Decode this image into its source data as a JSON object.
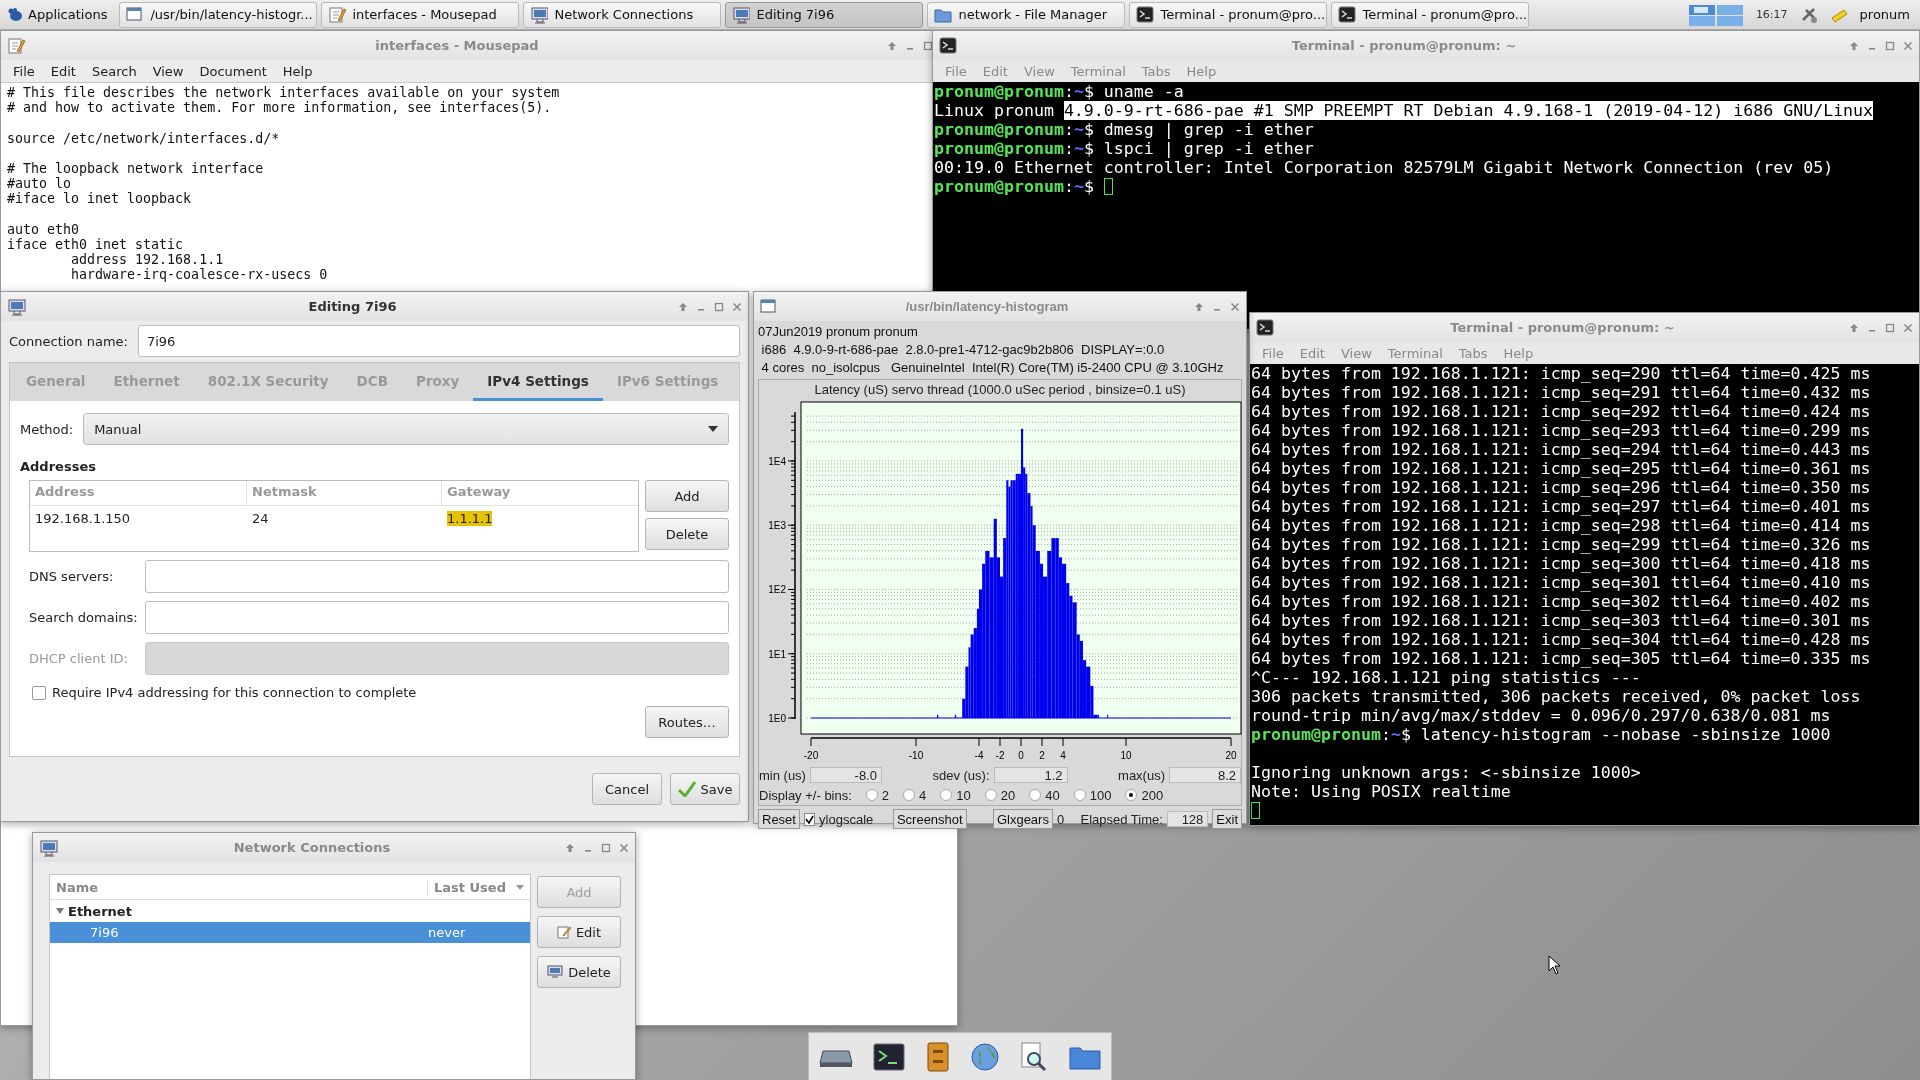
{
  "taskbar": {
    "menu_label": "Applications",
    "tasks": [
      {
        "title": "/usr/bin/latency-histogr...",
        "selected": false
      },
      {
        "title": "interfaces - Mousepad",
        "selected": false
      },
      {
        "title": "Network Connections",
        "selected": false
      },
      {
        "title": "Editing 7i96",
        "selected": true
      },
      {
        "title": "network - File Manager",
        "selected": false
      },
      {
        "title": "Terminal - pronum@pro...",
        "selected": false
      },
      {
        "title": "Terminal - pronum@pro...",
        "selected": false
      }
    ],
    "clock": "16:17",
    "user": "pronum"
  },
  "mousepad": {
    "title": "interfaces - Mousepad",
    "menu": [
      "File",
      "Edit",
      "Search",
      "View",
      "Document",
      "Help"
    ],
    "blocks": [
      [
        "# This file describes the network interfaces available on your system",
        "# and how to activate them. For more information, see interfaces(5)."
      ],
      [
        "source /etc/network/interfaces.d/*"
      ],
      [
        "# The loopback network interface",
        "#auto lo",
        "#iface lo inet loopback"
      ],
      [
        "auto eth0",
        "iface eth0 inet static",
        "        address 192.168.1.1",
        "        hardware-irq-coalesce-rx-usecs 0"
      ]
    ]
  },
  "terminal_top": {
    "title": "Terminal - pronum@pronum: ~",
    "menu": [
      "File",
      "Edit",
      "View",
      "Terminal",
      "Tabs",
      "Help"
    ],
    "lines": [
      {
        "kind": "prompt",
        "user": "pronum@pronum",
        "colon": ":",
        "dir": "~",
        "dollar": "$",
        "command": "uname -a"
      },
      {
        "kind": "output",
        "text": "Linux pronum ",
        "highlight": "4.9.0-9-rt-686-pae #1 SMP PREEMPT RT Debian 4.9.168-1 (2019-04-12) i686 GNU/Linux"
      },
      {
        "kind": "prompt",
        "user": "pronum@pronum",
        "colon": ":",
        "dir": "~",
        "dollar": "$",
        "command": "dmesg | grep -i ether"
      },
      {
        "kind": "prompt",
        "user": "pronum@pronum",
        "colon": ":",
        "dir": "~",
        "dollar": "$",
        "command": "lspci | grep -i ether"
      },
      {
        "kind": "output",
        "text": "00:19.0 Ethernet controller: Intel Corporation 82579LM Gigabit Network Connection (rev 05)"
      },
      {
        "kind": "prompt",
        "user": "pronum@pronum",
        "colon": ":",
        "dir": "~",
        "dollar": "$",
        "cursor": true
      }
    ]
  },
  "editing": {
    "title": "Editing 7i96",
    "connection_name_label": "Connection name:",
    "connection_name": "7i96",
    "tabs": [
      {
        "label": "General",
        "selected": false
      },
      {
        "label": "Ethernet",
        "selected": false
      },
      {
        "label": "802.1X Security",
        "selected": false
      },
      {
        "label": "DCB",
        "selected": false
      },
      {
        "label": "Proxy",
        "selected": false
      },
      {
        "label": "IPv4 Settings",
        "selected": true
      },
      {
        "label": "IPv6 Settings",
        "selected": false
      }
    ],
    "method_label": "Method:",
    "method": "Manual",
    "addresses_heading": "Addresses",
    "address_columns": [
      "Address",
      "Netmask",
      "Gateway"
    ],
    "address_rows": [
      {
        "cells": [
          {
            "text": "192.168.1.150",
            "selected": false
          },
          {
            "text": "24",
            "selected": false
          },
          {
            "text": "1.1.1.1",
            "selected": true
          }
        ]
      }
    ],
    "address_buttons": [
      "Add",
      "Delete"
    ],
    "fields": [
      {
        "label": "DNS servers:",
        "disabled": false
      },
      {
        "label": "Search domains:",
        "disabled": false
      },
      {
        "label": "DHCP client ID:",
        "disabled": true
      }
    ],
    "require_checkbox": {
      "label": "Require IPv4 addressing for this connection to complete",
      "checked": false
    },
    "routes_button": "Routes…",
    "buttons": [
      {
        "label": "Cancel",
        "kind": "plain"
      },
      {
        "label": "Save",
        "kind": "confirm"
      }
    ]
  },
  "histogram": {
    "title": "/usr/bin/latency-histogram",
    "info_lines": [
      "07Jun2019 pronum pronum",
      " i686  4.9.0-9-rt-686-pae  2.8.0-pre1-4712-gac9b2b806  DISPLAY=:0.0",
      " 4 cores  no_isolcpus   GenuineIntel  Intel(R) Core(TM) i5-2400 CPU @ 3.10GHz"
    ],
    "plot": {
      "title": "Latency (uS) servo thread (1000.0 uSec period , binsize=0.1 uS)",
      "x_labels": [
        "-20",
        "-10",
        "-4",
        "-2",
        "0",
        "2",
        "4",
        "10",
        "20"
      ],
      "y_labels": [
        "1E4",
        "1E3",
        "1E2",
        "1E1",
        "1E0"
      ]
    },
    "stats": [
      {
        "label": "min (us)",
        "value": "-8.0"
      },
      {
        "label": "sdev (us):",
        "value": "1.2"
      },
      {
        "label": "max(us)",
        "value": "8.2"
      }
    ],
    "bins_label": "Display +/- bins:",
    "bins": [
      {
        "label": "2",
        "selected": false
      },
      {
        "label": "4",
        "selected": false
      },
      {
        "label": "10",
        "selected": false
      },
      {
        "label": "20",
        "selected": false
      },
      {
        "label": "40",
        "selected": false
      },
      {
        "label": "100",
        "selected": false
      },
      {
        "label": "200",
        "selected": true
      }
    ],
    "reset_button": "Reset",
    "ylogscale": {
      "label": "ylogscale",
      "checked": true
    },
    "screenshot_button": "Screenshot",
    "glxgears_button": "Glxgears",
    "glxgears_count": "0",
    "elapsed_label": "Elapsed Time:",
    "elapsed_value": "128",
    "exit_button": "Exit"
  },
  "terminal_ping": {
    "title": "Terminal - pronum@pronum: ~",
    "menu": [
      "File",
      "Edit",
      "View",
      "Terminal",
      "Tabs",
      "Help"
    ],
    "lines": [
      {
        "kind": "output",
        "text": "64 bytes from 192.168.1.121: icmp_seq=290 ttl=64 time=0.425 ms"
      },
      {
        "kind": "output",
        "text": "64 bytes from 192.168.1.121: icmp_seq=291 ttl=64 time=0.432 ms"
      },
      {
        "kind": "output",
        "text": "64 bytes from 192.168.1.121: icmp_seq=292 ttl=64 time=0.424 ms"
      },
      {
        "kind": "output",
        "text": "64 bytes from 192.168.1.121: icmp_seq=293 ttl=64 time=0.299 ms"
      },
      {
        "kind": "output",
        "text": "64 bytes from 192.168.1.121: icmp_seq=294 ttl=64 time=0.443 ms"
      },
      {
        "kind": "output",
        "text": "64 bytes from 192.168.1.121: icmp_seq=295 ttl=64 time=0.361 ms"
      },
      {
        "kind": "output",
        "text": "64 bytes from 192.168.1.121: icmp_seq=296 ttl=64 time=0.350 ms"
      },
      {
        "kind": "output",
        "text": "64 bytes from 192.168.1.121: icmp_seq=297 ttl=64 time=0.401 ms"
      },
      {
        "kind": "output",
        "text": "64 bytes from 192.168.1.121: icmp_seq=298 ttl=64 time=0.414 ms"
      },
      {
        "kind": "output",
        "text": "64 bytes from 192.168.1.121: icmp_seq=299 ttl=64 time=0.326 ms"
      },
      {
        "kind": "output",
        "text": "64 bytes from 192.168.1.121: icmp_seq=300 ttl=64 time=0.418 ms"
      },
      {
        "kind": "output",
        "text": "64 bytes from 192.168.1.121: icmp_seq=301 ttl=64 time=0.410 ms"
      },
      {
        "kind": "output",
        "text": "64 bytes from 192.168.1.121: icmp_seq=302 ttl=64 time=0.402 ms"
      },
      {
        "kind": "output",
        "text": "64 bytes from 192.168.1.121: icmp_seq=303 ttl=64 time=0.301 ms"
      },
      {
        "kind": "output",
        "text": "64 bytes from 192.168.1.121: icmp_seq=304 ttl=64 time=0.428 ms"
      },
      {
        "kind": "output",
        "text": "64 bytes from 192.168.1.121: icmp_seq=305 ttl=64 time=0.335 ms"
      },
      {
        "kind": "output",
        "text": "^C--- 192.168.1.121 ping statistics ---"
      },
      {
        "kind": "output",
        "text": "306 packets transmitted, 306 packets received, 0% packet loss"
      },
      {
        "kind": "output",
        "text": "round-trip min/avg/max/stddev = 0.096/0.297/0.638/0.081 ms"
      },
      {
        "kind": "prompt",
        "user": "pronum@pronum",
        "colon": ":",
        "dir": "~",
        "dollar": "$",
        "command": "latency-histogram --nobase -sbinsize 1000"
      },
      {
        "kind": "blank"
      },
      {
        "kind": "output",
        "text": "Ignoring unknown args: <-sbinsize 1000>"
      },
      {
        "kind": "output",
        "text": "Note: Using POSIX realtime"
      },
      {
        "kind": "cursor"
      }
    ]
  },
  "network_connections": {
    "title": "Network Connections",
    "columns": [
      "Name",
      "Last Used"
    ],
    "groups": [
      {
        "name": "Ethernet",
        "expanded": true,
        "children": [
          {
            "name": "7i96",
            "last_used": "never",
            "selected": true
          }
        ]
      }
    ],
    "buttons": [
      {
        "label": "Add",
        "kind": "add",
        "disabled": true
      },
      {
        "label": "Edit",
        "kind": "edit",
        "disabled": false
      },
      {
        "label": "Delete",
        "kind": "delete",
        "disabled": false
      }
    ]
  }
}
